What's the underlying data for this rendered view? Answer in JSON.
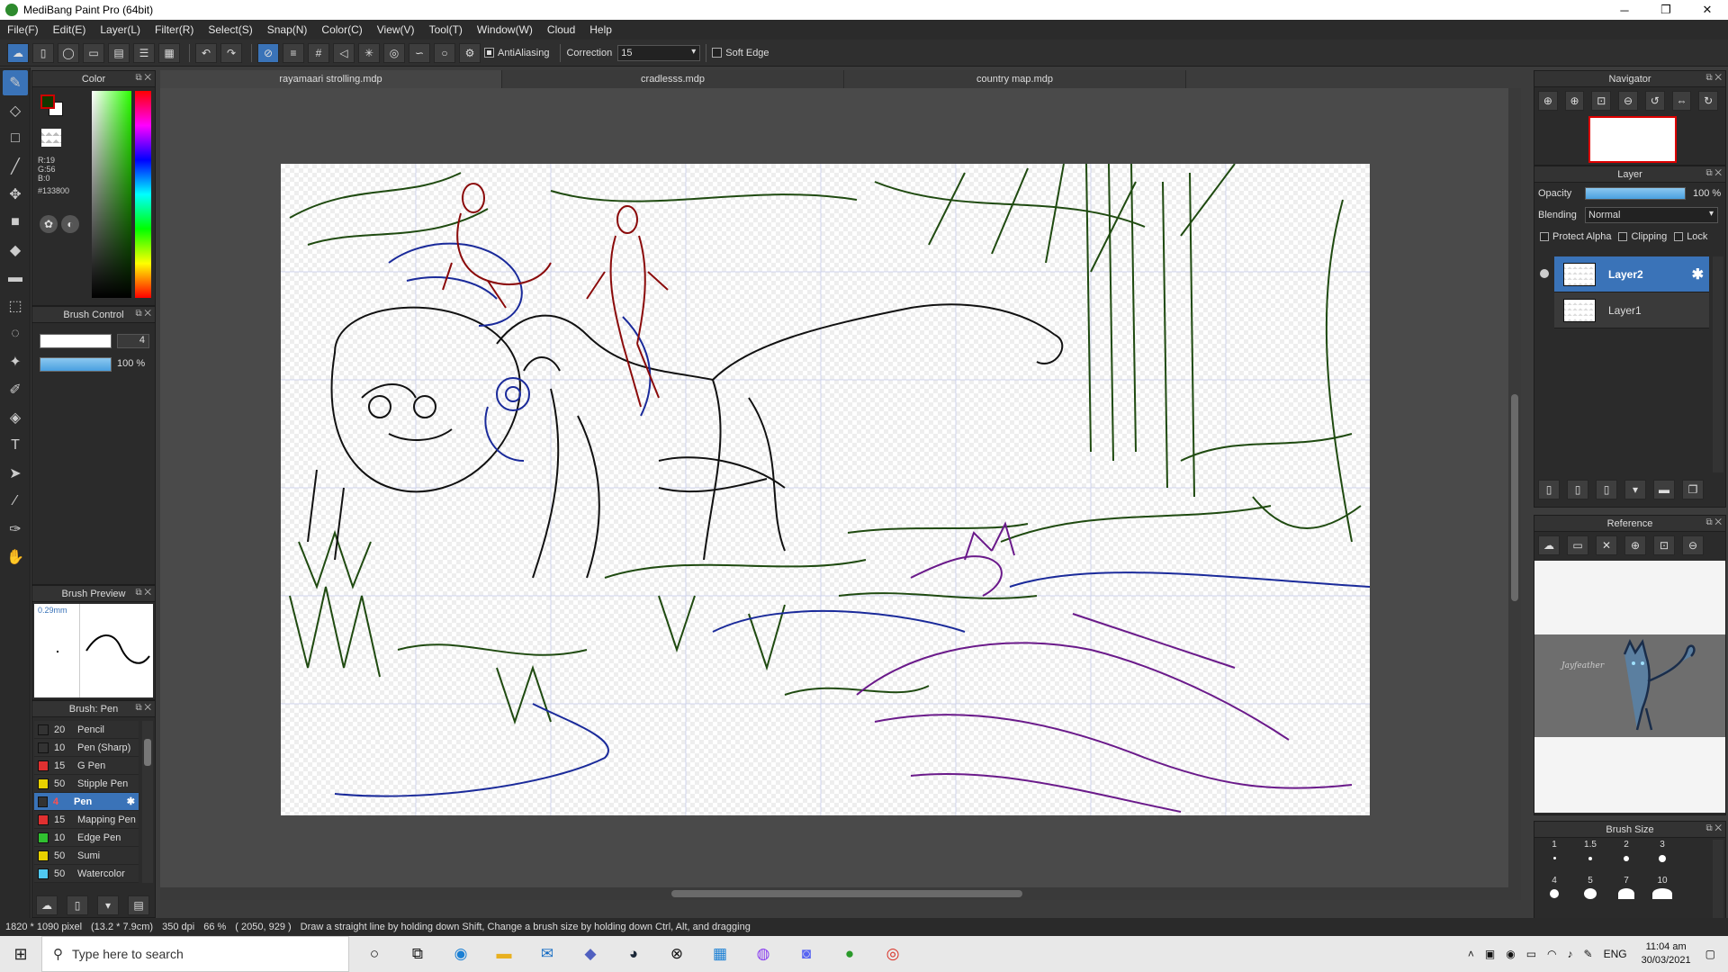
{
  "window": {
    "title": "MediBang Paint Pro (64bit)",
    "min": "─",
    "max": "❐",
    "close": "✕"
  },
  "menu": [
    "File(F)",
    "Edit(E)",
    "Layer(L)",
    "Filter(R)",
    "Select(S)",
    "Snap(N)",
    "Color(C)",
    "View(V)",
    "Tool(T)",
    "Window(W)",
    "Cloud",
    "Help"
  ],
  "toolbar": {
    "antialiasing": "AntiAliasing",
    "correction_label": "Correction",
    "correction_value": "15",
    "soft_edge": "Soft Edge"
  },
  "tabs": [
    "rayamaari strolling.mdp",
    "cradlesss.mdp",
    "country map.mdp"
  ],
  "color_panel": {
    "title": "Color",
    "r": "R:19",
    "g": "G:56",
    "b": "B:0",
    "hex": "#133800",
    "fg": "#133800",
    "bg": "#cc0000"
  },
  "brush_control": {
    "title": "Brush Control",
    "size": "4",
    "opacity": "100 %"
  },
  "brush_preview": {
    "title": "Brush Preview",
    "size": "0.29mm"
  },
  "brush_list": {
    "title": "Brush: Pen",
    "items": [
      {
        "size": "20",
        "name": "Pencil",
        "color": "#333333"
      },
      {
        "size": "10",
        "name": "Pen (Sharp)",
        "color": "#333333"
      },
      {
        "size": "15",
        "name": "G Pen",
        "color": "#e03030"
      },
      {
        "size": "50",
        "name": "Stipple Pen",
        "color": "#e8d000"
      },
      {
        "size": "4",
        "name": "Pen",
        "color": "#333333",
        "active": true
      },
      {
        "size": "15",
        "name": "Mapping Pen",
        "color": "#e03030"
      },
      {
        "size": "10",
        "name": "Edge Pen",
        "color": "#30c030"
      },
      {
        "size": "50",
        "name": "Sumi",
        "color": "#e8d000"
      },
      {
        "size": "50",
        "name": "Watercolor",
        "color": "#50c8f0"
      }
    ]
  },
  "navigator": {
    "title": "Navigator"
  },
  "layer_panel": {
    "title": "Layer",
    "opacity_label": "Opacity",
    "opacity_value": "100 %",
    "blending_label": "Blending",
    "blending_value": "Normal",
    "protect_alpha": "Protect Alpha",
    "clipping": "Clipping",
    "lock": "Lock",
    "layers": [
      {
        "name": "Layer2",
        "active": true
      },
      {
        "name": "Layer1",
        "active": false
      }
    ]
  },
  "reference": {
    "title": "Reference",
    "signature": "Jayfeather"
  },
  "brush_size": {
    "title": "Brush Size",
    "row1": [
      "1",
      "1.5",
      "2",
      "3"
    ],
    "row2": [
      "4",
      "5",
      "7",
      "10"
    ]
  },
  "status": {
    "pixel": "1820 * 1090 pixel",
    "cm": "(13.2 * 7.9cm)",
    "dpi": "350 dpi",
    "zoom": "66 %",
    "coords": "( 2050, 929 )",
    "hint": "Draw a straight line by holding down Shift, Change a brush size by holding down Ctrl, Alt, and dragging"
  },
  "taskbar": {
    "search_placeholder": "Type here to search",
    "lang": "ENG",
    "time": "11:04 am",
    "date": "30/03/2021"
  }
}
